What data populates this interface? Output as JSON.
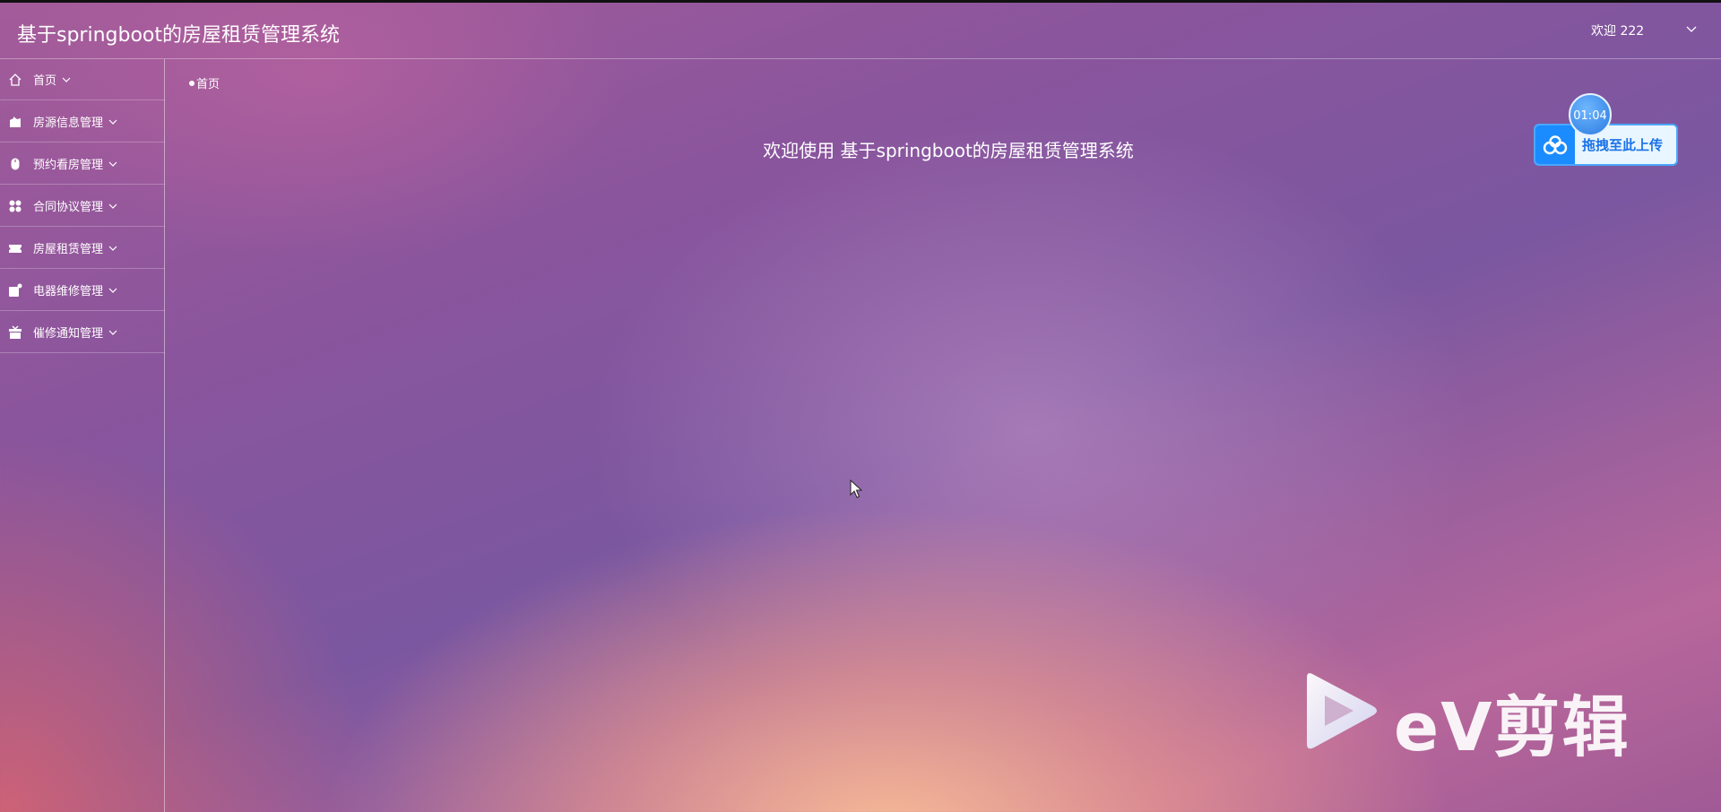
{
  "header": {
    "title": "基于springboot的房屋租赁管理系统",
    "user_greeting": "欢迎 222"
  },
  "sidebar": {
    "items": [
      {
        "label": "首页",
        "icon": "home-icon"
      },
      {
        "label": "房源信息管理",
        "icon": "house-icon"
      },
      {
        "label": "预约看房管理",
        "icon": "mouse-icon"
      },
      {
        "label": "合同协议管理",
        "icon": "grid-dots-icon"
      },
      {
        "label": "房屋租赁管理",
        "icon": "ticket-icon"
      },
      {
        "label": "电器维修管理",
        "icon": "wrench-box-icon"
      },
      {
        "label": "催修通知管理",
        "icon": "gift-box-icon"
      }
    ]
  },
  "breadcrumb": {
    "current": "首页"
  },
  "main": {
    "welcome": "欢迎使用 基于springboot的房屋租赁管理系统"
  },
  "overlay": {
    "timer": "01:04",
    "upload_label": "拖拽至此上传",
    "watermark": "eV剪辑"
  }
}
